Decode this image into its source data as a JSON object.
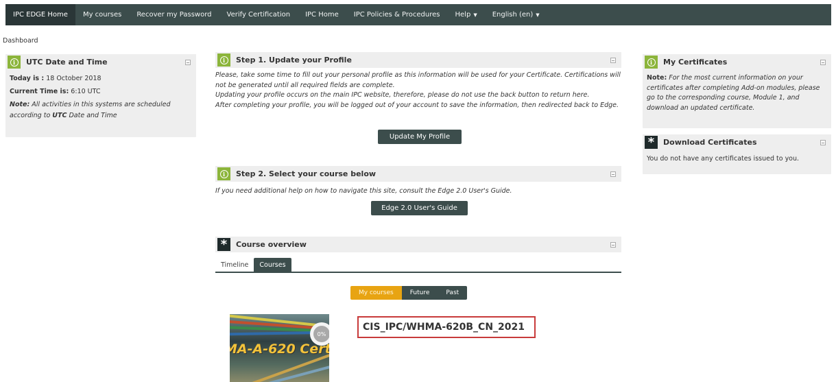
{
  "navbar": {
    "items": [
      {
        "label": "IPC EDGE Home"
      },
      {
        "label": "My courses"
      },
      {
        "label": "Recover my Password"
      },
      {
        "label": "Verify Certification"
      },
      {
        "label": "IPC Home"
      },
      {
        "label": "IPC Policies & Procedures"
      },
      {
        "label": "Help"
      },
      {
        "label": "English (en)"
      }
    ]
  },
  "breadcrumb": "Dashboard",
  "utc_block": {
    "title": "UTC Date and Time",
    "today_label": "Today is :",
    "today_value": " 18 October 2018",
    "time_label": "Current Time is:",
    "time_value": " 6:10 UTC",
    "note_label": "Note:",
    "note_text1": " All activities in this systems are scheduled according to ",
    "note_bold": "UTC",
    "note_text2": " Date and Time"
  },
  "step1": {
    "title": "Step 1. Update your Profile",
    "line1": "Please, take some time to fill out your personal profile as this information will be used for your Certificate. Certifications will not be generated until all required fields are complete.",
    "line2": "Updating your profile occurs on the main IPC website, therefore, please do not use the back button to return here.",
    "line3": "After completing your profile, you will be logged out of your account to save the information, then redirected back to Edge.",
    "button": "Update My Profile"
  },
  "step2": {
    "title": "Step 2. Select your course below",
    "text": "If you need additional help on how to navigate this site, consult the Edge 2.0 User's Guide.",
    "button": "Edge 2.0 User's Guide"
  },
  "course_overview": {
    "title": "Course overview",
    "tabs": [
      {
        "label": "Timeline"
      },
      {
        "label": "Courses"
      }
    ],
    "filters": [
      {
        "label": "My courses"
      },
      {
        "label": "Future"
      },
      {
        "label": "Past"
      }
    ],
    "progress": "0%",
    "image_text": "MA-A-620 Cert",
    "course_name": "CIS_IPC/WHMA-620B_CN_2021"
  },
  "certificates": {
    "title": "My Certificates",
    "note_label": "Note:",
    "note_text": " For the most current information on your certificates after completing Add-on modules, please go to the corresponding course, Module 1, and download an updated certificate."
  },
  "downloads": {
    "title": "Download Certificates",
    "text": "You do not have any certificates issued to you."
  },
  "colors": {
    "navbar": "#3c4d4c",
    "accent_green": "#8cb53b",
    "active_filter": "#e8a412",
    "highlight_border": "#c83a3a"
  }
}
